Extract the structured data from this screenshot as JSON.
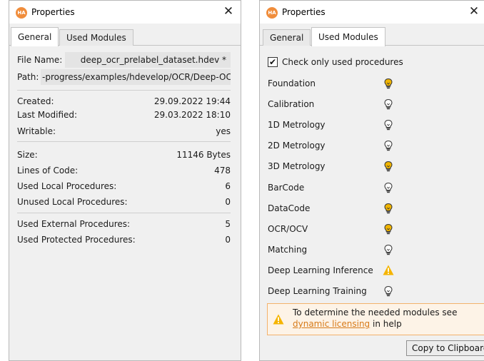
{
  "app": {
    "icon_text": "HA",
    "accent": "#f08d3c"
  },
  "left_window": {
    "title": "Properties",
    "close_glyph": "✕",
    "tabs": [
      {
        "label": "General",
        "active": true
      },
      {
        "label": "Used Modules",
        "active": false
      }
    ],
    "file_name": {
      "label": "File Name:",
      "value": "deep_ocr_prelabel_dataset.hdev *"
    },
    "path": {
      "label": "Path:",
      "value": "-progress/examples/hdevelop/OCR/Deep-OCR"
    },
    "dates": [
      {
        "label": "Created:",
        "value": "29.09.2022 19:44"
      },
      {
        "label": "Last Modified:",
        "value": "29.03.2022 18:10"
      },
      {
        "label": "Writable:",
        "value": "yes"
      }
    ],
    "stats": [
      {
        "label": "Size:",
        "value": "11146 Bytes"
      },
      {
        "label": "Lines of Code:",
        "value": "478"
      },
      {
        "label": "Used Local Procedures:",
        "value": "6"
      },
      {
        "label": "Unused Local Procedures:",
        "value": "0"
      }
    ],
    "external": [
      {
        "label": "Used External Procedures:",
        "value": "5"
      },
      {
        "label": "Used Protected Procedures:",
        "value": "0"
      }
    ]
  },
  "right_window": {
    "title": "Properties",
    "close_glyph": "✕",
    "tabs": [
      {
        "label": "General",
        "active": false
      },
      {
        "label": "Used Modules",
        "active": true
      }
    ],
    "check_only_used": {
      "label": "Check only used procedures",
      "checked": true,
      "glyph": "✔"
    },
    "modules": [
      {
        "name": "Foundation",
        "status": "bulb-on-icon"
      },
      {
        "name": "Calibration",
        "status": "bulb-off-icon"
      },
      {
        "name": "1D Metrology",
        "status": "bulb-off-icon"
      },
      {
        "name": "2D Metrology",
        "status": "bulb-off-icon"
      },
      {
        "name": "3D Metrology",
        "status": "bulb-on-icon"
      },
      {
        "name": "BarCode",
        "status": "bulb-off-icon"
      },
      {
        "name": "DataCode",
        "status": "bulb-on-icon"
      },
      {
        "name": "OCR/OCV",
        "status": "bulb-on-icon"
      },
      {
        "name": "Matching",
        "status": "bulb-off-icon"
      },
      {
        "name": "Deep Learning Inference",
        "status": "warning-icon"
      },
      {
        "name": "Deep Learning Training",
        "status": "bulb-off-icon"
      }
    ],
    "help": {
      "line1": "To determine the needed modules see",
      "link": "dynamic licensing",
      "line2_suffix": " in help"
    },
    "copy_button": "Copy to Clipboard"
  },
  "colors": {
    "bulb_on": "#f0b400",
    "bulb_off": "#ffffff",
    "warning": "#f5b400",
    "link": "#d77a18"
  }
}
